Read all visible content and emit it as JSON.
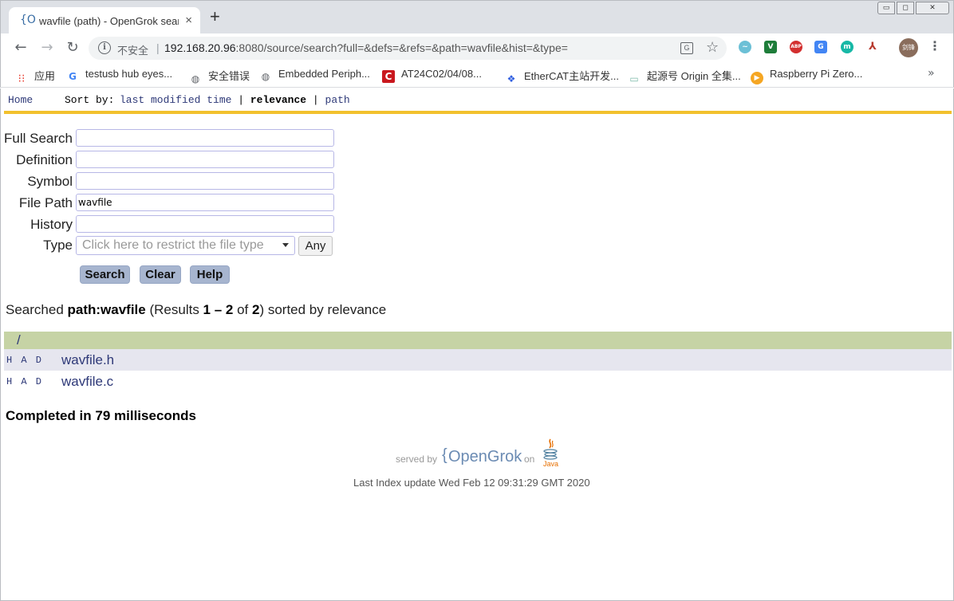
{
  "browser": {
    "tab_title": "wavfile (path) - OpenGrok search",
    "tab_favicon": "{O",
    "tab_close": "×",
    "new_tab": "+",
    "window_controls": {
      "minimize": "▭",
      "maximize": "◻",
      "close": "✕"
    },
    "security_label": "不安全",
    "url_host": "192.168.20.96",
    "url_rest": ":8080/source/search?full=&defs=&refs=&path=wavfile&hist=&type=",
    "avatar_text": "剑锋",
    "bookmarks": [
      {
        "label": "应用",
        "icon": "apps-grid-icon"
      },
      {
        "label": "testusb hub eyes...",
        "icon": "google-icon"
      },
      {
        "label": "安全错误",
        "icon": "globe-icon"
      },
      {
        "label": "Embedded Periph...",
        "icon": "globe-icon"
      },
      {
        "label": "AT24C02/04/08...",
        "icon": "csdn-icon"
      },
      {
        "label": "EtherCAT主站开发...",
        "icon": "baidu-paw-icon"
      },
      {
        "label": "起源号 Origin 全集...",
        "icon": "tv-icon"
      },
      {
        "label": "Raspberry Pi Zero...",
        "icon": "play-icon"
      }
    ],
    "bookmarks_more": "»"
  },
  "opengrok": {
    "menu": {
      "home": "Home",
      "sort_by": "Sort by:"
    },
    "sort_options": {
      "last_modified": "last modified time",
      "relevance": "relevance",
      "path": "path",
      "separator": "|"
    },
    "form": {
      "full_search": {
        "label": "Full Search",
        "value": ""
      },
      "definition": {
        "label": "Definition",
        "value": ""
      },
      "symbol": {
        "label": "Symbol",
        "value": ""
      },
      "file_path": {
        "label": "File Path",
        "value": "wavfile"
      },
      "history": {
        "label": "History",
        "value": ""
      },
      "type": {
        "label": "Type",
        "placeholder": "Click here to restrict the file type",
        "any_label": "Any"
      }
    },
    "buttons": {
      "search": "Search",
      "clear": "Clear",
      "help": "Help"
    },
    "summary": {
      "prefix": "Searched ",
      "query": "path:wavfile",
      "results_open": " (Results ",
      "range": "1 – 2",
      "of": " of ",
      "total": "2",
      "suffix": ") sorted by relevance"
    },
    "results": {
      "directory": "/",
      "files": [
        {
          "had": "H A D",
          "name": "wavfile.h"
        },
        {
          "had": "H A D",
          "name": "wavfile.c"
        }
      ]
    },
    "completed": "Completed in 79 milliseconds",
    "footer": {
      "served_by": "served by",
      "brand_brace": "{",
      "brand_name": "OpenGrok",
      "on": "on",
      "java_label": "Java",
      "last_index": "Last Index update Wed Feb 12 09:31:29 GMT 2020"
    },
    "colors": {
      "accent_bar": "#f2c12e",
      "dir_row": "#c6d3a5",
      "alt_row": "#e6e6ef",
      "link": "#2e3978",
      "button": "#a7b5cf"
    }
  }
}
